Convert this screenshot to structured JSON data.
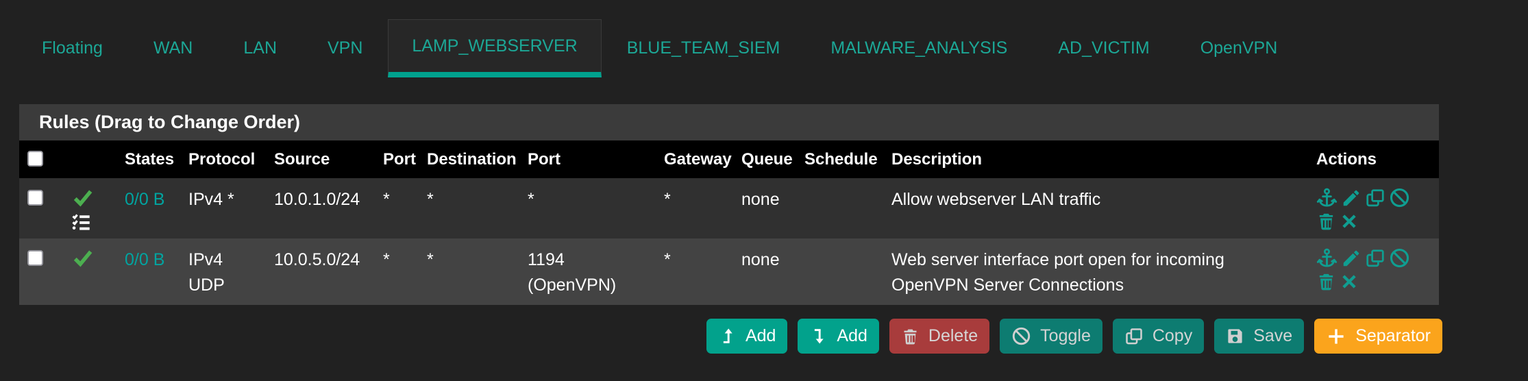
{
  "colors": {
    "page_bg": "#212121",
    "accent_teal": "#1ca796",
    "active_tab_underline": "#00a28e",
    "states_teal": "#00a4a0",
    "check_green": "#4caf50",
    "panel_heading_bg": "#3b3b3b",
    "table_header_bg": "#000000",
    "row_odd_bg": "#303030",
    "row_even_bg": "#434343",
    "button_add_bg": "#02a28c",
    "button_secondary_bg": "#0d7c71",
    "button_delete_bg": "#a83c3c",
    "button_separator_bg": "#fba41c"
  },
  "tabs": {
    "active": "LAMP_WEBSERVER",
    "items": [
      {
        "label": "Floating"
      },
      {
        "label": "WAN"
      },
      {
        "label": "LAN"
      },
      {
        "label": "VPN"
      },
      {
        "label": "LAMP_WEBSERVER"
      },
      {
        "label": "BLUE_TEAM_SIEM"
      },
      {
        "label": "MALWARE_ANALYSIS"
      },
      {
        "label": "AD_VICTIM"
      },
      {
        "label": "OpenVPN"
      }
    ]
  },
  "panel": {
    "title": "Rules (Drag to Change Order)",
    "headers": {
      "states": "States",
      "protocol": "Protocol",
      "source": "Source",
      "port_src": "Port",
      "destination": "Destination",
      "port_dst": "Port",
      "gateway": "Gateway",
      "queue": "Queue",
      "schedule": "Schedule",
      "description": "Description",
      "actions": "Actions"
    },
    "action_icon_names": [
      "anchor-icon",
      "pencil-icon",
      "copy-icon",
      "ban-icon",
      "trash-icon",
      "close-icon"
    ],
    "rows": [
      {
        "status": "enabled",
        "states": "0/0 B",
        "protocol_line1": "IPv4 *",
        "protocol_line2": "",
        "source": "10.0.1.0/24",
        "port_src": "*",
        "destination": "*",
        "port_dst_line1": "*",
        "port_dst_line2": "",
        "gateway": "*",
        "queue": "none",
        "schedule": "",
        "description_line1": "Allow webserver LAN traffic",
        "description_line2": ""
      },
      {
        "status": "enabled",
        "states": "0/0 B",
        "protocol_line1": "IPv4",
        "protocol_line2": "UDP",
        "source": "10.0.5.0/24",
        "port_src": "*",
        "destination": "*",
        "port_dst_line1": "1194",
        "port_dst_line2": "(OpenVPN)",
        "gateway": "*",
        "queue": "none",
        "schedule": "",
        "description_line1": "Web server interface port open for incoming",
        "description_line2": "OpenVPN Server Connections"
      }
    ]
  },
  "toolbar": {
    "buttons": [
      {
        "label": "Add",
        "icon": "level-up-icon"
      },
      {
        "label": "Add",
        "icon": "level-down-icon"
      },
      {
        "label": "Delete",
        "icon": "trash-icon"
      },
      {
        "label": "Toggle",
        "icon": "ban-icon"
      },
      {
        "label": "Copy",
        "icon": "copy-icon"
      },
      {
        "label": "Save",
        "icon": "save-icon"
      },
      {
        "label": "Separator",
        "icon": "plus-icon"
      }
    ]
  }
}
